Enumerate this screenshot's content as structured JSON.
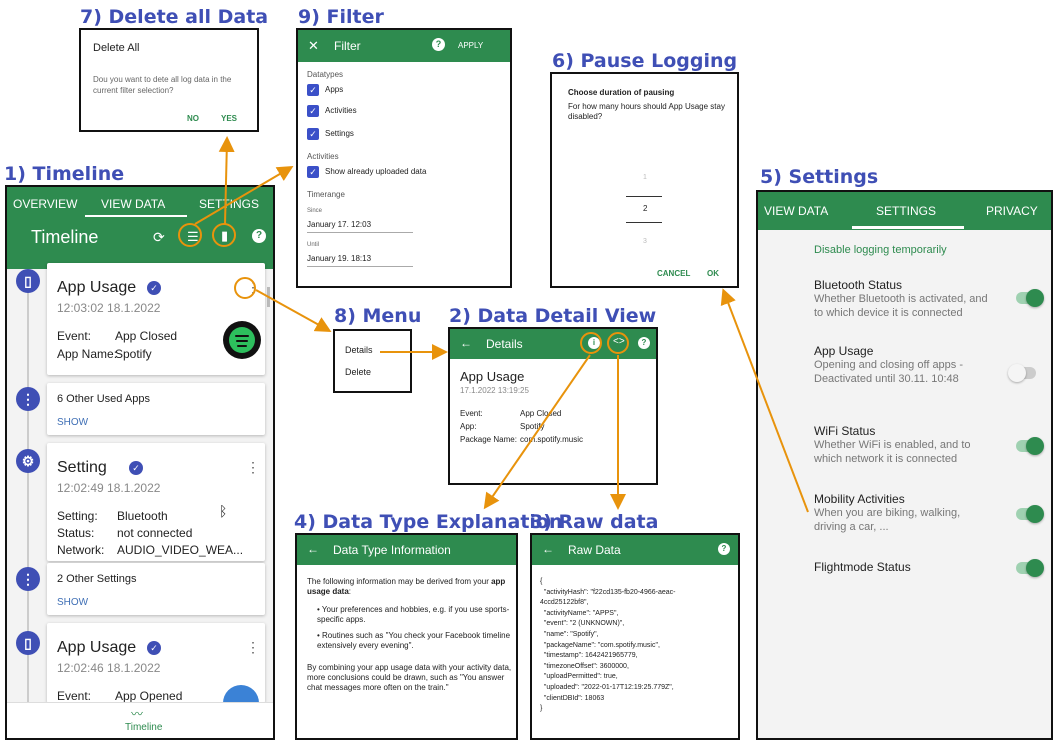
{
  "sections": {
    "delete": "7) Delete all Data",
    "filter": "9) Filter",
    "pause": "6) Pause Logging",
    "timeline": "1) Timeline",
    "settings": "5) Settings",
    "menu": "8) Menu",
    "detail": "2) Data Detail View",
    "explain": "4) Data Type Explanation",
    "raw": "3) Raw data"
  },
  "delete_dialog": {
    "title": "Delete All",
    "message": "Dou you want to dete all log data in the current filter selection?",
    "no": "NO",
    "yes": "YES"
  },
  "filter": {
    "title": "Filter",
    "apply": "APPLY",
    "datatypes_label": "Datatypes",
    "datatypes": [
      "Apps",
      "Activities",
      "Settings"
    ],
    "activities_label": "Activities",
    "show_uploaded": "Show already uploaded data",
    "timerange_label": "Timerange",
    "since_label": "Since",
    "since_value": "January 17. 12:03",
    "until_label": "Until",
    "until_value": "January 19. 18:13"
  },
  "pause": {
    "title": "Choose duration of pausing",
    "message": "For how many hours should App Usage stay disabled?",
    "picker": [
      "1",
      "2",
      "3"
    ],
    "cancel": "CANCEL",
    "ok": "OK"
  },
  "timeline": {
    "tabs": [
      "OVERVIEW",
      "VIEW DATA",
      "SETTINGS"
    ],
    "title": "Timeline",
    "card1_title": "App Usage",
    "card1_time": "12:03:02 18.1.2022",
    "card1_event_label": "Event:",
    "card1_event": "App Closed",
    "card1_app_label": "App Name:",
    "card1_app": "Spotify",
    "group1": "6 Other Used Apps",
    "show": "SHOW",
    "card2_title": "Setting",
    "card2_time": "12:02:49 18.1.2022",
    "card2_setting_label": "Setting:",
    "card2_setting": "Bluetooth",
    "card2_status_label": "Status:",
    "card2_status": "not connected",
    "card2_network_label": "Network:",
    "card2_network": "AUDIO_VIDEO_WEA...",
    "group2": "2 Other Settings",
    "card3_title": "App Usage",
    "card3_time": "12:02:46 18.1.2022",
    "card3_event_label": "Event:",
    "card3_event": "App Opened",
    "bottom_nav": "Timeline"
  },
  "menu": {
    "items": [
      "Details",
      "Delete"
    ]
  },
  "detail": {
    "title": "Details",
    "heading": "App Usage",
    "time": "17.1.2022 13:19:25",
    "rows": [
      {
        "k": "Event:",
        "v": "App Closed"
      },
      {
        "k": "App:",
        "v": "Spotify"
      },
      {
        "k": "Package Name:",
        "v": "com.spotify.music"
      }
    ]
  },
  "settings": {
    "tabs": [
      "VIEW DATA",
      "SETTINGS",
      "PRIVACY"
    ],
    "disable_link": "Disable logging temporarily",
    "items": [
      {
        "title": "Bluetooth Status",
        "sub": "Whether Bluetooth is activated, and to which device it is connected",
        "on": true
      },
      {
        "title": "App Usage",
        "sub": "Opening and closing off apps - Deactivated until 30.11. 10:48",
        "on": false
      },
      {
        "title": "WiFi Status",
        "sub": "Whether WiFi is enabled, and to which network it is connected",
        "on": true
      },
      {
        "title": "Mobility Activities",
        "sub": "When you are biking, walking, driving a car, ...",
        "on": true
      },
      {
        "title": "Flightmode Status",
        "sub": "",
        "on": true
      }
    ]
  },
  "explain": {
    "title": "Data Type Information",
    "intro": "The following information may be derived from your",
    "intro_bold": "app usage data",
    "bullet1": "Your preferences and hobbies, e.g. if you use sports-specific apps.",
    "bullet2": "Routines such as \"You check your Facebook timeline extensively every evening\".",
    "outro": "By combining your app usage data with your activity data, more conclusions could be drawn, such as \"You answer chat messages more often on the train.\""
  },
  "raw": {
    "title": "Raw Data",
    "lines": [
      "{",
      "  \"activityHash\": \"f22cd135-fb20-4966-aeac-",
      "4ccd25122bf8\",",
      "  \"activityName\": \"APPS\",",
      "  \"event\": \"2 (UNKNOWN)\",",
      "  \"name\": \"Spotify\",",
      "  \"packageName\": \"com.spotify.music\",",
      "  \"timestamp\": 1642421965779,",
      "  \"timezoneOffset\": 3600000,",
      "  \"uploadPermitted\": true,",
      "  \"uploaded\": \"2022-01-17T12:19:25.779Z\",",
      "  \"clientDBId\": 18063",
      "}"
    ]
  },
  "colors": {
    "green": "#2e8b4f",
    "blue": "#3f4fb5",
    "arrow": "#e8930c"
  }
}
